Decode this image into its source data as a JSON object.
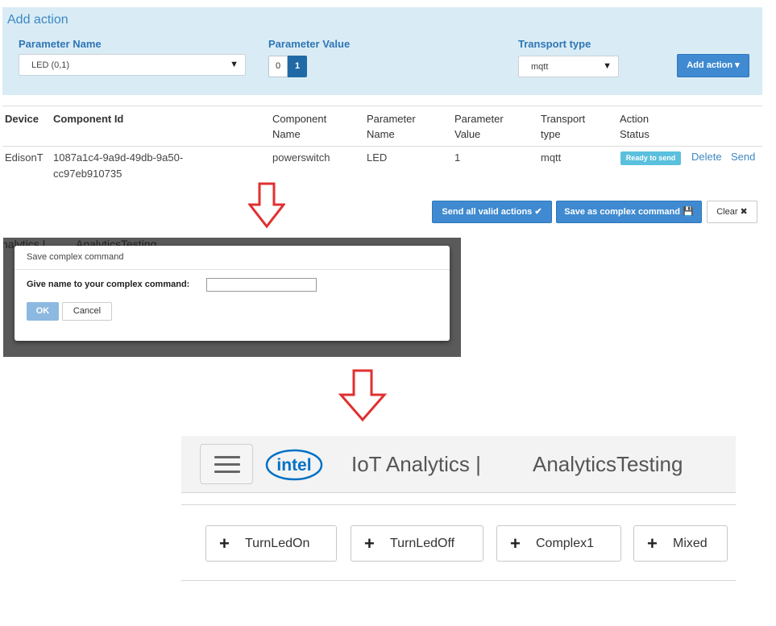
{
  "add_action": {
    "title": "Add action",
    "parameter_name_label": "Parameter Name",
    "parameter_name_value": "LED (0,1)",
    "parameter_value_label": "Parameter Value",
    "toggle_options": [
      "0",
      "1"
    ],
    "toggle_selected": "1",
    "transport_type_label": "Transport type",
    "transport_type_value": "mqtt",
    "add_button": "Add action ▾"
  },
  "table": {
    "headers": [
      "Device",
      "Component Id",
      "Component Name",
      "Parameter Name",
      "Parameter Value",
      "Transport type",
      "Action Status"
    ],
    "header_lines": {
      "component_name": [
        "Component",
        "Name"
      ],
      "parameter_name": [
        "Parameter",
        "Name"
      ],
      "parameter_value": [
        "Parameter",
        "Value"
      ],
      "transport_type": [
        "Transport",
        "type"
      ],
      "action_status": [
        "Action",
        "Status"
      ]
    },
    "row": {
      "device": "EdisonT",
      "component_id_line1": "1087a1c4-9a9d-49db-9a50-",
      "component_id_line2": "cc97eb910735",
      "component_name": "powerswitch",
      "parameter_name": "LED",
      "parameter_value": "1",
      "transport_type": "mqtt",
      "status": "Ready to send",
      "delete_label": "Delete",
      "send_label": "Send"
    },
    "send_all_button": "Send all valid actions ✔",
    "save_complex_button": "Save as complex command 💾",
    "clear_button": "Clear ✖"
  },
  "dialog": {
    "background_tabs": [
      "nalytics |",
      "AnalyticsTesting"
    ],
    "title": "Save complex command",
    "label": "Give name to your complex command:",
    "input_value": "",
    "ok_button": "OK",
    "cancel_button": "Cancel"
  },
  "iot": {
    "logo_text": "intel",
    "title": "IoT Analytics |",
    "app_name": "AnalyticsTesting",
    "commands": [
      {
        "plus": "+",
        "label": "TurnLedOn"
      },
      {
        "plus": "+",
        "label": "TurnLedOff"
      },
      {
        "plus": "+",
        "label": "Complex1"
      },
      {
        "plus": "+",
        "label": "Mixed"
      }
    ]
  },
  "colors": {
    "panel_bg": "#d9ecf5",
    "accent_blue": "#3f8ad0",
    "badge_blue": "#5bc0de",
    "arrow_red": "#e03030",
    "intel_blue": "#0071c5"
  },
  "icons": [
    "down-arrow-icon",
    "chevron-down-icon",
    "checkmark-icon",
    "save-icon",
    "close-icon",
    "hamburger-menu-icon",
    "intel-logo",
    "plus-icon"
  ]
}
